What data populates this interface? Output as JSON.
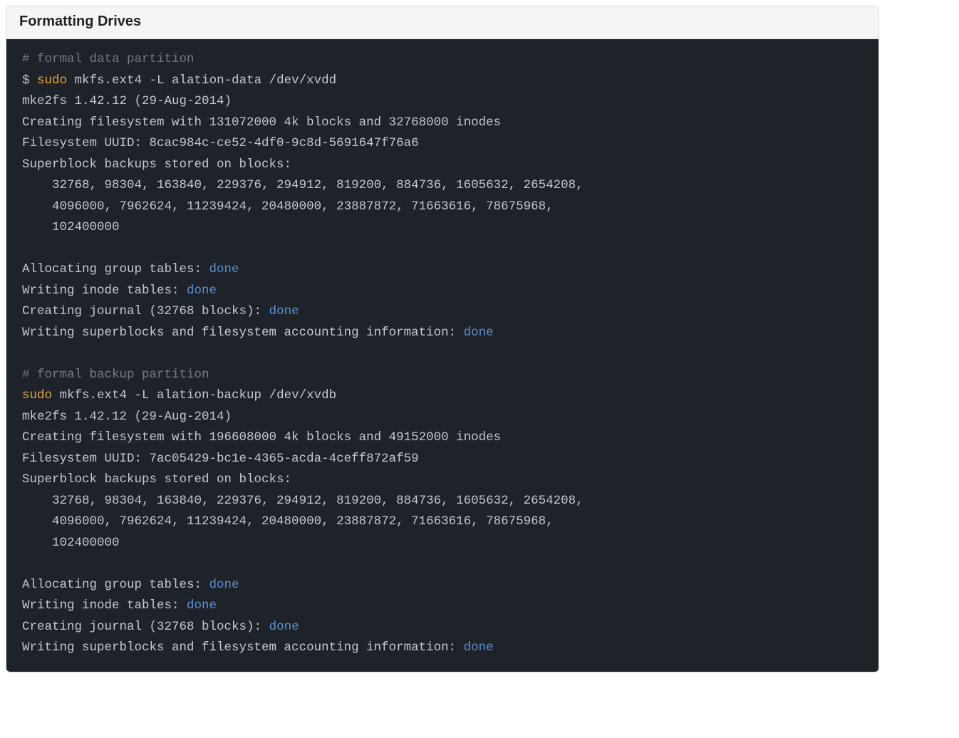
{
  "panel": {
    "title": "Formatting Drives"
  },
  "colors": {
    "comment": "#6f7a85",
    "sudo": "#e8a33d",
    "done": "#5f8ed0",
    "text": "#c2c8d0",
    "code_bg": "#1d2329",
    "header_bg": "#f5f5f5"
  },
  "code": {
    "lines": [
      [
        {
          "t": "# formal data partition",
          "c": "comment"
        }
      ],
      [
        {
          "t": "$ ",
          "c": "text"
        },
        {
          "t": "sudo",
          "c": "sudo"
        },
        {
          "t": " mkfs.ext4 -L alation-data /dev/xvdd",
          "c": "text"
        }
      ],
      [
        {
          "t": "mke2fs 1.42.12 (29-Aug-2014)",
          "c": "text"
        }
      ],
      [
        {
          "t": "Creating filesystem with 131072000 4k blocks and 32768000 inodes",
          "c": "text"
        }
      ],
      [
        {
          "t": "Filesystem UUID: 8cac984c-ce52-4df0-9c8d-5691647f76a6",
          "c": "text"
        }
      ],
      [
        {
          "t": "Superblock backups stored on blocks:",
          "c": "text"
        }
      ],
      [
        {
          "t": "    32768, 98304, 163840, 229376, 294912, 819200, 884736, 1605632, 2654208,",
          "c": "text"
        }
      ],
      [
        {
          "t": "    4096000, 7962624, 11239424, 20480000, 23887872, 71663616, 78675968,",
          "c": "text"
        }
      ],
      [
        {
          "t": "    102400000",
          "c": "text"
        }
      ],
      [
        {
          "t": "",
          "c": "text"
        }
      ],
      [
        {
          "t": "Allocating group tables: ",
          "c": "text"
        },
        {
          "t": "done",
          "c": "done"
        }
      ],
      [
        {
          "t": "Writing inode tables: ",
          "c": "text"
        },
        {
          "t": "done",
          "c": "done"
        }
      ],
      [
        {
          "t": "Creating journal (32768 blocks): ",
          "c": "text"
        },
        {
          "t": "done",
          "c": "done"
        }
      ],
      [
        {
          "t": "Writing superblocks and filesystem accounting information: ",
          "c": "text"
        },
        {
          "t": "done",
          "c": "done"
        }
      ],
      [
        {
          "t": "",
          "c": "text"
        }
      ],
      [
        {
          "t": "# formal backup partition",
          "c": "comment"
        }
      ],
      [
        {
          "t": "sudo",
          "c": "sudo"
        },
        {
          "t": " mkfs.ext4 -L alation-backup /dev/xvdb",
          "c": "text"
        }
      ],
      [
        {
          "t": "mke2fs 1.42.12 (29-Aug-2014)",
          "c": "text"
        }
      ],
      [
        {
          "t": "Creating filesystem with 196608000 4k blocks and 49152000 inodes",
          "c": "text"
        }
      ],
      [
        {
          "t": "Filesystem UUID: 7ac05429-bc1e-4365-acda-4ceff872af59",
          "c": "text"
        }
      ],
      [
        {
          "t": "Superblock backups stored on blocks:",
          "c": "text"
        }
      ],
      [
        {
          "t": "    32768, 98304, 163840, 229376, 294912, 819200, 884736, 1605632, 2654208,",
          "c": "text"
        }
      ],
      [
        {
          "t": "    4096000, 7962624, 11239424, 20480000, 23887872, 71663616, 78675968,",
          "c": "text"
        }
      ],
      [
        {
          "t": "    102400000",
          "c": "text"
        }
      ],
      [
        {
          "t": "",
          "c": "text"
        }
      ],
      [
        {
          "t": "Allocating group tables: ",
          "c": "text"
        },
        {
          "t": "done",
          "c": "done"
        }
      ],
      [
        {
          "t": "Writing inode tables: ",
          "c": "text"
        },
        {
          "t": "done",
          "c": "done"
        }
      ],
      [
        {
          "t": "Creating journal (32768 blocks): ",
          "c": "text"
        },
        {
          "t": "done",
          "c": "done"
        }
      ],
      [
        {
          "t": "Writing superblocks and filesystem accounting information: ",
          "c": "text"
        },
        {
          "t": "done",
          "c": "done"
        }
      ]
    ]
  }
}
